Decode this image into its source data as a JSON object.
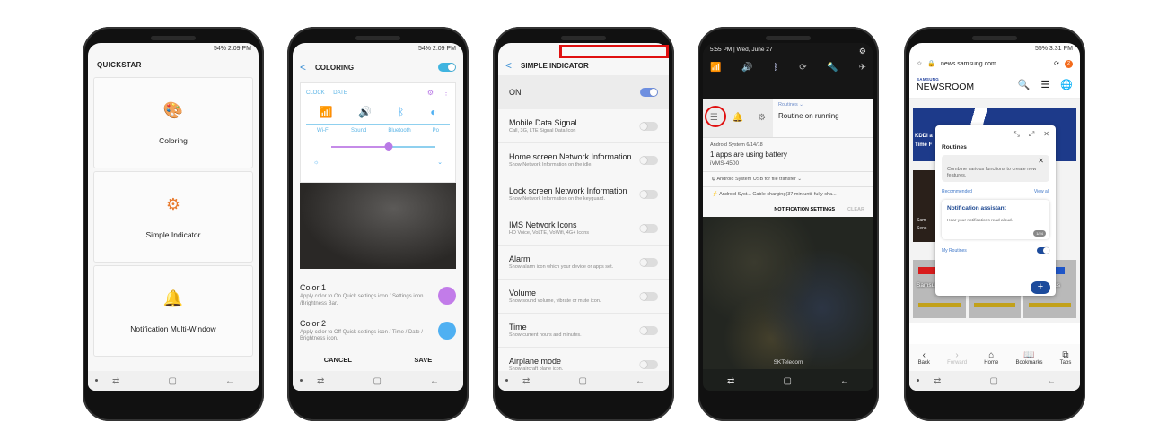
{
  "phones": {
    "quickstar": {
      "status": "54% 2:09 PM",
      "title": "QUICKSTAR",
      "cards": [
        {
          "label": "Coloring",
          "icon": "palette-icon",
          "color": "#3a7bd5"
        },
        {
          "label": "Simple Indicator",
          "icon": "signal-gear-icon",
          "color": "#e87a2d"
        },
        {
          "label": "Notification Multi-Window",
          "icon": "bell-window-icon",
          "color": "#2aa4e6"
        }
      ]
    },
    "coloring": {
      "status": "54% 2:09 PM",
      "title": "COLORING",
      "enabled": true,
      "preview": {
        "clock": "CLOCK",
        "date": "DATE",
        "tiles": [
          "Wi-Fi",
          "Sound",
          "Bluetooth",
          "Po"
        ],
        "brightness_level": 0.55
      },
      "colors": [
        {
          "title": "Color 1",
          "desc": "Apply color to On Quick settings icon / Settings icon /Brightness Bar.",
          "swatch": "#c27ce9"
        },
        {
          "title": "Color 2",
          "desc": "Apply color to Off Quick settings icon / Time / Date / Brightness icon.",
          "swatch": "#4fb0f2"
        }
      ],
      "cancel": "CANCEL",
      "save": "SAVE"
    },
    "simple_indicator": {
      "title": "SIMPLE INDICATOR",
      "master_label": "ON",
      "master_on": true,
      "items": [
        {
          "title": "Mobile Data Signal",
          "desc": "Call, 3G, LTE Signal Data Icon",
          "on": false
        },
        {
          "title": "Home screen Network Information",
          "desc": "Show Network Information on the idle.",
          "on": false
        },
        {
          "title": "Lock screen Network Information",
          "desc": "Show Network Information on the keyguard.",
          "on": false
        },
        {
          "title": "IMS Network Icons",
          "desc": "HD Voice, VoLTE, VoWifi, 4G+ Icons",
          "on": false
        },
        {
          "title": "Alarm",
          "desc": "Show alarm icon which your device or apps set.",
          "on": false
        },
        {
          "title": "Volume",
          "desc": "Show sound volume, vibrate or mute icon.",
          "on": false
        },
        {
          "title": "Time",
          "desc": "Show current hours and minutes.",
          "on": false
        },
        {
          "title": "Airplane mode",
          "desc": "Show aircraft plane icon.",
          "on": false
        }
      ]
    },
    "notification_panel": {
      "time": "5:55 PM",
      "date": "Wed, June 27",
      "routine_label": "Routines",
      "routine_status": "Routine on running",
      "notifications": [
        {
          "app": "Android System",
          "date": "6/14/18",
          "title": "1 apps are using battery",
          "body": "iVMS-4500"
        }
      ],
      "compact": [
        {
          "app": "Android System",
          "text": "USB for file transfer"
        },
        {
          "app": "Android Syst...",
          "text": "Cable charging(37 min until fully cha..."
        }
      ],
      "settings_btn": "NOTIFICATION SETTINGS",
      "clear_btn": "CLEAR",
      "carrier": "SKTelecom"
    },
    "browser": {
      "status": "55% 3:31 PM",
      "url": "news.samsung.com",
      "badge": "2",
      "logo_top": "SAMSUNG",
      "logo_main": "NEWSROOM",
      "banner_text": [
        "KDDI a",
        "Time F"
      ],
      "side_text": [
        "Sam",
        "Sens"
      ],
      "thumb_caption": "Samsung Brings Sleek Xcover... with New SOCKS Plus",
      "popup": {
        "title": "Routines",
        "tip": "Combine various functions to create new features.",
        "recommended": "Recommended",
        "view_all": "View all",
        "card_title": "Notification assistant",
        "card_desc": "Hear your notifications read aloud.",
        "card_page": "1/24",
        "my_routines": "My Routines"
      },
      "toolbar": [
        "Back",
        "Forward",
        "Home",
        "Bookmarks",
        "Tabs"
      ]
    }
  }
}
